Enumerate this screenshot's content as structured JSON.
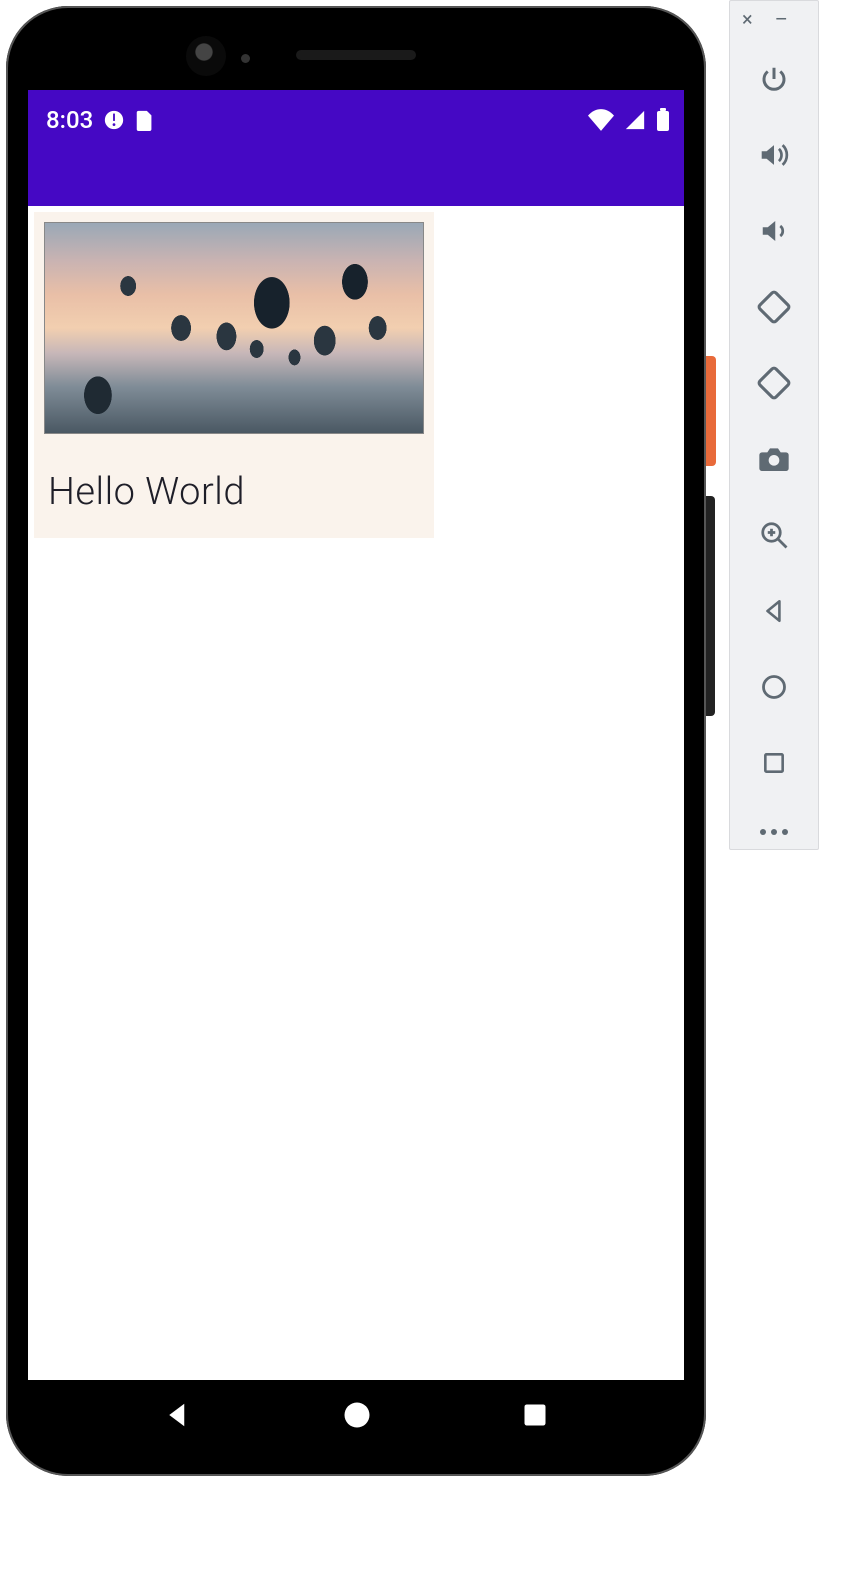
{
  "status_bar": {
    "time": "8:03",
    "icons_left": [
      "clock-alert-icon",
      "sim-icon"
    ],
    "icons_right": [
      "wifi-icon",
      "signal-icon",
      "battery-icon"
    ]
  },
  "card": {
    "title": "Hello World",
    "image_alt": "hot air balloons at sunset"
  },
  "nav": {
    "back": "Back",
    "home": "Home",
    "recents": "Recents"
  },
  "emulator_toolbar": {
    "window_close": "Close",
    "window_minimize": "Minimize",
    "buttons": [
      {
        "name": "power-icon",
        "label": "Power"
      },
      {
        "name": "volume-up-icon",
        "label": "Volume up"
      },
      {
        "name": "volume-down-icon",
        "label": "Volume down"
      },
      {
        "name": "rotate-left-icon",
        "label": "Rotate left"
      },
      {
        "name": "rotate-right-icon",
        "label": "Rotate right"
      },
      {
        "name": "camera-icon",
        "label": "Take screenshot"
      },
      {
        "name": "zoom-icon",
        "label": "Zoom"
      },
      {
        "name": "back-icon",
        "label": "Back"
      },
      {
        "name": "home-icon",
        "label": "Home"
      },
      {
        "name": "overview-icon",
        "label": "Overview"
      }
    ],
    "more": "More"
  }
}
